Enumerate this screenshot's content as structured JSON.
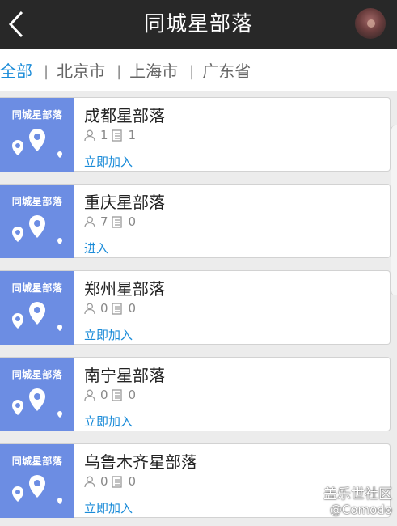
{
  "header": {
    "title": "同城星部落"
  },
  "tabs": [
    {
      "label": "全部"
    },
    {
      "label": "北京市"
    },
    {
      "label": "上海市"
    },
    {
      "label": "广东省"
    }
  ],
  "tab_separator": "|",
  "cards": [
    {
      "thumb_label": "同城星部落",
      "name": "成都星部落",
      "members": "1",
      "posts": "1",
      "action": "立即加入"
    },
    {
      "thumb_label": "同城星部落",
      "name": "重庆星部落",
      "members": "7",
      "posts": "0",
      "action": "进入"
    },
    {
      "thumb_label": "同城星部落",
      "name": "郑州星部落",
      "members": "0",
      "posts": "0",
      "action": "立即加入"
    },
    {
      "thumb_label": "同城星部落",
      "name": "南宁星部落",
      "members": "0",
      "posts": "0",
      "action": "立即加入"
    },
    {
      "thumb_label": "同城星部落",
      "name": "乌鲁木齐星部落",
      "members": "0",
      "posts": "0",
      "action": "立即加入"
    }
  ],
  "watermark": {
    "line1": "盖乐世社区",
    "line2": "@Comodo"
  },
  "colors": {
    "accent": "#1a8bd8",
    "header_bg": "#282828",
    "thumb_bg": "#6c8de3"
  },
  "icons": {
    "back": "chevron-left-icon",
    "member": "person-icon",
    "post": "document-icon",
    "pin": "map-pin-icon"
  }
}
